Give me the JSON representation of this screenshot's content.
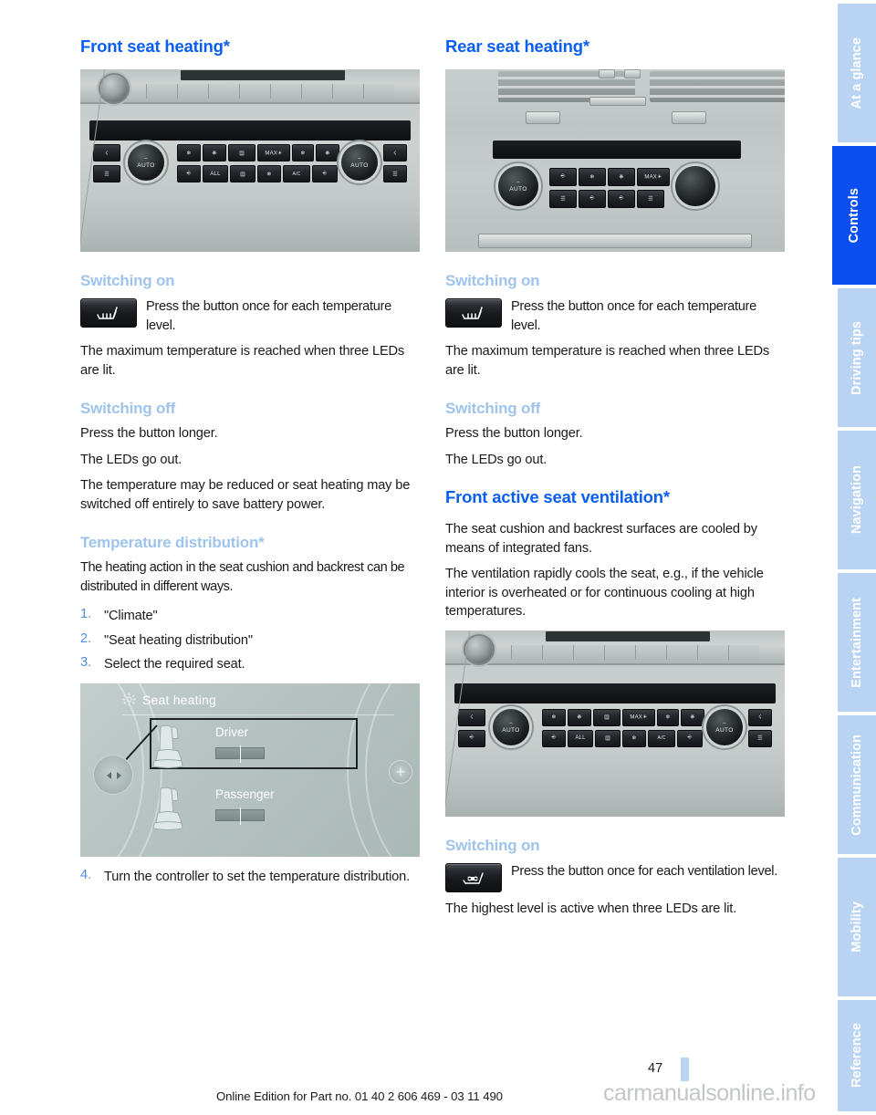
{
  "page": {
    "number": "47",
    "footer_note": "Online Edition for Part no. 01 40 2 606 469 - 03 11 490",
    "watermark": "carmanualsonline.info"
  },
  "colors": {
    "heading_blue": "#0a5ef0",
    "subheading_blue": "#9ec4ec",
    "tab_inactive": "#b9d3f2",
    "tab_active": "#0a4ef0",
    "body_text": "#1a1a1a",
    "list_number": "#4a8fe0"
  },
  "left_column": {
    "title": "Front seat heating*",
    "photo_caption": "front-climate-control-panel",
    "switching_on": {
      "heading": "Switching on",
      "button_icon": "seat-heating-icon",
      "button_text": "Press the button once for each temperature level.",
      "note": "The maximum temperature is reached when three LEDs are lit."
    },
    "switching_off": {
      "heading": "Switching off",
      "line1": "Press the button longer.",
      "line2": "The LEDs go out.",
      "line3": "The temperature may be reduced or seat heating may be switched off entirely to save battery power."
    },
    "temperature_distribution": {
      "heading": "Temperature distribution*",
      "intro": "The heating action in the seat cushion and backrest can be distributed in different ways.",
      "steps": [
        {
          "num": "1.",
          "text": "\"Climate\""
        },
        {
          "num": "2.",
          "text": "\"Seat heating distribution\""
        },
        {
          "num": "3.",
          "text": "Select the required seat."
        }
      ],
      "step4": {
        "num": "4.",
        "text": "Turn the controller to set the temperature distribution."
      }
    },
    "idrive_screen": {
      "title": "Seat heating",
      "gear_icon": "settings-gear-icon",
      "rows": [
        {
          "label": "Driver",
          "seat_icon": "car-seat-icon",
          "selected": true
        },
        {
          "label": "Passenger",
          "seat_icon": "car-seat-icon",
          "selected": false
        }
      ],
      "plus_label": "+",
      "dpad_icon": "dpad-left-right-icon"
    }
  },
  "right_column": {
    "title": "Rear seat heating*",
    "photo_caption": "rear-climate-control-panel",
    "switching_on": {
      "heading": "Switching on",
      "button_icon": "seat-heating-icon",
      "button_text": "Press the button once for each temperature level.",
      "note": "The maximum temperature is reached when three LEDs are lit."
    },
    "switching_off": {
      "heading": "Switching off",
      "line1": "Press the button longer.",
      "line2": "The LEDs go out."
    },
    "ventilation": {
      "title": "Front active seat ventilation*",
      "para1": "The seat cushion and backrest surfaces are cooled by means of integrated fans.",
      "para2": "The ventilation rapidly cools the seat, e.g., if the vehicle interior is overheated or for continuous cooling at high temperatures.",
      "photo_caption": "front-climate-control-panel-ventilation",
      "switching_on": {
        "heading": "Switching on",
        "button_icon": "seat-ventilation-icon",
        "button_text": "Press the button once for each ventilation level.",
        "note": "The highest level is active when three LEDs are lit."
      }
    }
  },
  "sidebar": {
    "tabs": [
      {
        "label": "At a glance",
        "active": false
      },
      {
        "label": "Controls",
        "active": true
      },
      {
        "label": "Driving tips",
        "active": false
      },
      {
        "label": "Navigation",
        "active": false
      },
      {
        "label": "Entertainment",
        "active": false
      },
      {
        "label": "Communication",
        "active": false
      },
      {
        "label": "Mobility",
        "active": false
      },
      {
        "label": "Reference",
        "active": false
      }
    ]
  }
}
